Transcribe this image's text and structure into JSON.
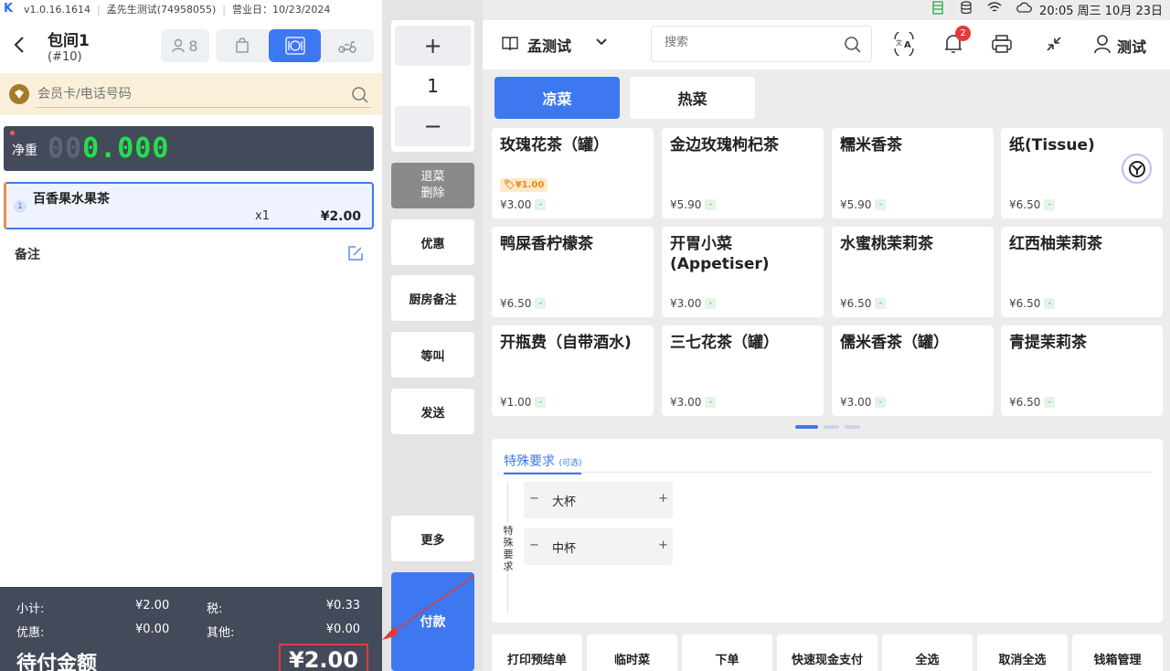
{
  "status_left": {
    "version": "v1.0.16.1614",
    "store_account": "孟先生测试(74958055)",
    "business_day": "营业日：10/23/2024"
  },
  "status_right": {
    "clock": "20:05 周三 10月 23日"
  },
  "order_header": {
    "table_name": "包间1",
    "table_no": "(#10)",
    "guests": "8"
  },
  "member": {
    "placeholder": "会员卡/电话号码"
  },
  "scale": {
    "label": "净重",
    "dim_digits": "00",
    "lit_digits": "0.000"
  },
  "order_items": [
    {
      "index": "1",
      "name": "百香果水果茶",
      "qty": "x1",
      "price": "¥2.00"
    }
  ],
  "note": {
    "label": "备注"
  },
  "totals": {
    "subtotal_label": "小计:",
    "subtotal": "¥2.00",
    "tax_label": "税:",
    "tax": "¥0.33",
    "discount_label": "优惠:",
    "discount": "¥0.00",
    "other_label": "其他:",
    "other": "¥0.00",
    "due_label": "待付金额",
    "due": "¥2.00"
  },
  "middle": {
    "qty_plus": "+",
    "qty_value": "1",
    "qty_minus": "−",
    "void_line1": "退菜",
    "void_line2": "删除",
    "discount": "优惠",
    "kitchen_note": "厨房备注",
    "hold": "等叫",
    "send": "发送",
    "more": "更多",
    "pay": "付款"
  },
  "topbar": {
    "store": "孟测试",
    "search_placeholder": "搜索",
    "bell_count": "2",
    "user": "测试"
  },
  "categories": [
    {
      "label": "凉菜",
      "active": true
    },
    {
      "label": "热菜",
      "active": false
    }
  ],
  "dishes": [
    {
      "name": "玫瑰花茶（罐）",
      "price": "¥3.00",
      "tag": "¥1.00"
    },
    {
      "name": "金边玫瑰枸杞茶",
      "price": "¥5.90"
    },
    {
      "name": "糯米香茶",
      "price": "¥5.90"
    },
    {
      "name": "纸(Tissue)",
      "price": "¥6.50"
    },
    {
      "name": "鸭屎香柠檬茶",
      "price": "¥6.50"
    },
    {
      "name": "开胃小菜(Appetiser)",
      "price": "¥3.00"
    },
    {
      "name": "水蜜桃茉莉茶",
      "price": "¥6.50"
    },
    {
      "name": "红西柚茉莉茶",
      "price": "¥6.50"
    },
    {
      "name": "开瓶费（自带酒水)",
      "price": "¥1.00"
    },
    {
      "name": "三七花茶（罐）",
      "price": "¥3.00"
    },
    {
      "name": "儒米香茶（罐）",
      "price": "¥3.00"
    },
    {
      "name": "青提茉莉茶",
      "price": "¥6.50"
    }
  ],
  "price_chip": "-",
  "special": {
    "title": "特殊要求",
    "title_hint": "(可选)",
    "vertical_label": "特殊要求",
    "options": [
      {
        "name": "大杯",
        "minus": "−",
        "plus": "+"
      },
      {
        "name": "中杯",
        "minus": "−",
        "plus": "+"
      }
    ]
  },
  "actions": [
    "打印预结单",
    "临时菜",
    "下单",
    "快速现金支付",
    "全选",
    "取消全选",
    "钱箱管理"
  ],
  "colors": {
    "primary": "#3e78f0",
    "panel_dark": "#434a59",
    "member_bg": "#faf0da",
    "scale_digit": "#23e04a",
    "alert": "#e03b3b"
  }
}
